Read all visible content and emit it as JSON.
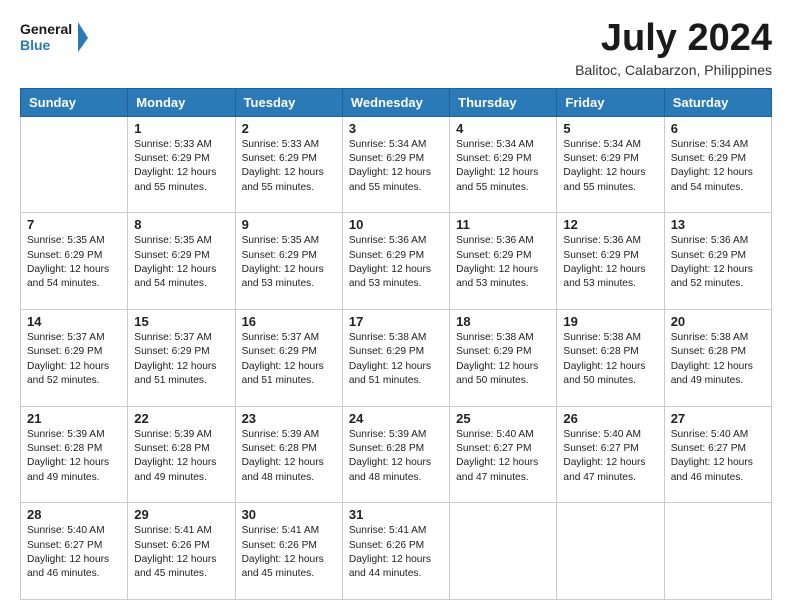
{
  "header": {
    "logo": {
      "line1": "General",
      "line2": "Blue",
      "icon_color": "#2a7ab8"
    },
    "title": "July 2024",
    "subtitle": "Balitoc, Calabarzon, Philippines"
  },
  "columns": [
    "Sunday",
    "Monday",
    "Tuesday",
    "Wednesday",
    "Thursday",
    "Friday",
    "Saturday"
  ],
  "weeks": [
    [
      {
        "day": "",
        "info": ""
      },
      {
        "day": "1",
        "info": "Sunrise: 5:33 AM\nSunset: 6:29 PM\nDaylight: 12 hours\nand 55 minutes."
      },
      {
        "day": "2",
        "info": "Sunrise: 5:33 AM\nSunset: 6:29 PM\nDaylight: 12 hours\nand 55 minutes."
      },
      {
        "day": "3",
        "info": "Sunrise: 5:34 AM\nSunset: 6:29 PM\nDaylight: 12 hours\nand 55 minutes."
      },
      {
        "day": "4",
        "info": "Sunrise: 5:34 AM\nSunset: 6:29 PM\nDaylight: 12 hours\nand 55 minutes."
      },
      {
        "day": "5",
        "info": "Sunrise: 5:34 AM\nSunset: 6:29 PM\nDaylight: 12 hours\nand 55 minutes."
      },
      {
        "day": "6",
        "info": "Sunrise: 5:34 AM\nSunset: 6:29 PM\nDaylight: 12 hours\nand 54 minutes."
      }
    ],
    [
      {
        "day": "7",
        "info": "Sunrise: 5:35 AM\nSunset: 6:29 PM\nDaylight: 12 hours\nand 54 minutes."
      },
      {
        "day": "8",
        "info": "Sunrise: 5:35 AM\nSunset: 6:29 PM\nDaylight: 12 hours\nand 54 minutes."
      },
      {
        "day": "9",
        "info": "Sunrise: 5:35 AM\nSunset: 6:29 PM\nDaylight: 12 hours\nand 53 minutes."
      },
      {
        "day": "10",
        "info": "Sunrise: 5:36 AM\nSunset: 6:29 PM\nDaylight: 12 hours\nand 53 minutes."
      },
      {
        "day": "11",
        "info": "Sunrise: 5:36 AM\nSunset: 6:29 PM\nDaylight: 12 hours\nand 53 minutes."
      },
      {
        "day": "12",
        "info": "Sunrise: 5:36 AM\nSunset: 6:29 PM\nDaylight: 12 hours\nand 53 minutes."
      },
      {
        "day": "13",
        "info": "Sunrise: 5:36 AM\nSunset: 6:29 PM\nDaylight: 12 hours\nand 52 minutes."
      }
    ],
    [
      {
        "day": "14",
        "info": "Sunrise: 5:37 AM\nSunset: 6:29 PM\nDaylight: 12 hours\nand 52 minutes."
      },
      {
        "day": "15",
        "info": "Sunrise: 5:37 AM\nSunset: 6:29 PM\nDaylight: 12 hours\nand 51 minutes."
      },
      {
        "day": "16",
        "info": "Sunrise: 5:37 AM\nSunset: 6:29 PM\nDaylight: 12 hours\nand 51 minutes."
      },
      {
        "day": "17",
        "info": "Sunrise: 5:38 AM\nSunset: 6:29 PM\nDaylight: 12 hours\nand 51 minutes."
      },
      {
        "day": "18",
        "info": "Sunrise: 5:38 AM\nSunset: 6:29 PM\nDaylight: 12 hours\nand 50 minutes."
      },
      {
        "day": "19",
        "info": "Sunrise: 5:38 AM\nSunset: 6:28 PM\nDaylight: 12 hours\nand 50 minutes."
      },
      {
        "day": "20",
        "info": "Sunrise: 5:38 AM\nSunset: 6:28 PM\nDaylight: 12 hours\nand 49 minutes."
      }
    ],
    [
      {
        "day": "21",
        "info": "Sunrise: 5:39 AM\nSunset: 6:28 PM\nDaylight: 12 hours\nand 49 minutes."
      },
      {
        "day": "22",
        "info": "Sunrise: 5:39 AM\nSunset: 6:28 PM\nDaylight: 12 hours\nand 49 minutes."
      },
      {
        "day": "23",
        "info": "Sunrise: 5:39 AM\nSunset: 6:28 PM\nDaylight: 12 hours\nand 48 minutes."
      },
      {
        "day": "24",
        "info": "Sunrise: 5:39 AM\nSunset: 6:28 PM\nDaylight: 12 hours\nand 48 minutes."
      },
      {
        "day": "25",
        "info": "Sunrise: 5:40 AM\nSunset: 6:27 PM\nDaylight: 12 hours\nand 47 minutes."
      },
      {
        "day": "26",
        "info": "Sunrise: 5:40 AM\nSunset: 6:27 PM\nDaylight: 12 hours\nand 47 minutes."
      },
      {
        "day": "27",
        "info": "Sunrise: 5:40 AM\nSunset: 6:27 PM\nDaylight: 12 hours\nand 46 minutes."
      }
    ],
    [
      {
        "day": "28",
        "info": "Sunrise: 5:40 AM\nSunset: 6:27 PM\nDaylight: 12 hours\nand 46 minutes."
      },
      {
        "day": "29",
        "info": "Sunrise: 5:41 AM\nSunset: 6:26 PM\nDaylight: 12 hours\nand 45 minutes."
      },
      {
        "day": "30",
        "info": "Sunrise: 5:41 AM\nSunset: 6:26 PM\nDaylight: 12 hours\nand 45 minutes."
      },
      {
        "day": "31",
        "info": "Sunrise: 5:41 AM\nSunset: 6:26 PM\nDaylight: 12 hours\nand 44 minutes."
      },
      {
        "day": "",
        "info": ""
      },
      {
        "day": "",
        "info": ""
      },
      {
        "day": "",
        "info": ""
      }
    ]
  ]
}
